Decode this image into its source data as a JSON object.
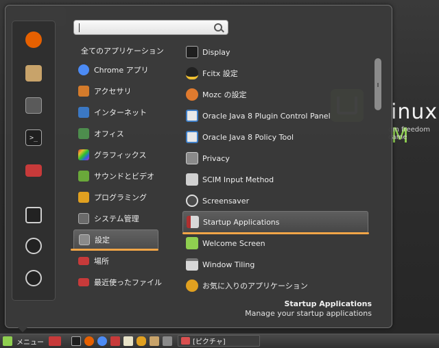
{
  "desktop": {
    "brand_prefix": "inux",
    "brand_suffix": "M",
    "tagline": "om freedom came"
  },
  "favorites": [
    {
      "name": "firefox",
      "color": "#e66000"
    },
    {
      "name": "package-manager",
      "color": "#c8a36a"
    },
    {
      "name": "system-settings",
      "color": "#5a5a5a"
    },
    {
      "name": "terminal",
      "color": "#1f1f1f"
    },
    {
      "name": "folder",
      "color": "#c73a3a"
    },
    {
      "name": "lock-screen",
      "color": "#2a2a2a"
    },
    {
      "name": "logout",
      "color": "#2a2a2a"
    },
    {
      "name": "shutdown",
      "color": "#2a2a2a"
    }
  ],
  "search": {
    "placeholder": ""
  },
  "categories": {
    "header": "全てのアプリケーション",
    "items": [
      {
        "label": "Chrome アプリ",
        "color": "#4c8bf5"
      },
      {
        "label": "アクセサリ",
        "color": "#d47b2b"
      },
      {
        "label": "インターネット",
        "color": "#3b78c4"
      },
      {
        "label": "オフィス",
        "color": "#4d8d4d"
      },
      {
        "label": "グラフィックス",
        "color": "#c644c6"
      },
      {
        "label": "サウンドとビデオ",
        "color": "#6aa83a"
      },
      {
        "label": "プログラミング",
        "color": "#e0a020"
      },
      {
        "label": "システム管理",
        "color": "#6a6a6a"
      },
      {
        "label": "設定",
        "color": "#8a8a8a"
      },
      {
        "label": "場所",
        "color": "#c73a3a"
      },
      {
        "label": "最近使ったファイル",
        "color": "#c73a3a"
      }
    ],
    "active_index": 8
  },
  "apps": {
    "items": [
      {
        "label": "Display",
        "color": "#1f1f1f"
      },
      {
        "label": "Fcitx 設定",
        "color": "#f0c030"
      },
      {
        "label": "Mozc の設定",
        "color": "#e07a2e"
      },
      {
        "label": "Oracle Java 8 Plugin Control Panel",
        "color": "#3f7fc8"
      },
      {
        "label": "Oracle Java 8 Policy Tool",
        "color": "#3f7fc8"
      },
      {
        "label": "Privacy",
        "color": "#8a8a8a"
      },
      {
        "label": "SCIM Input Method",
        "color": "#d0d0d0"
      },
      {
        "label": "Screensaver",
        "color": "#4a4a4a"
      },
      {
        "label": "Startup Applications",
        "color": "#b03030"
      },
      {
        "label": "Welcome Screen",
        "color": "#8fcf50"
      },
      {
        "label": "Window Tiling",
        "color": "#d8d8d8"
      },
      {
        "label": "お気に入りのアプリケーション",
        "color": "#e0a020"
      }
    ],
    "active_index": 8
  },
  "description": {
    "title": "Startup Applications",
    "subtitle": "Manage your startup applications"
  },
  "taskbar": {
    "menu_label": "メニュー",
    "window_label": "[ピクチャ]",
    "launchers": [
      {
        "name": "show-desktop",
        "color": "#c73a3a"
      },
      {
        "name": "terminal",
        "color": "#1f1f1f"
      },
      {
        "name": "firefox",
        "color": "#e66000"
      },
      {
        "name": "chrome",
        "color": "#4c8bf5"
      },
      {
        "name": "folder",
        "color": "#c73a3a"
      },
      {
        "name": "text-editor",
        "color": "#e8e3c8"
      },
      {
        "name": "butterfly",
        "color": "#e0a020"
      },
      {
        "name": "image-viewer",
        "color": "#c8a36a"
      },
      {
        "name": "screenshot",
        "color": "#8a8a8a"
      }
    ]
  },
  "accent_color": "#f2a547"
}
